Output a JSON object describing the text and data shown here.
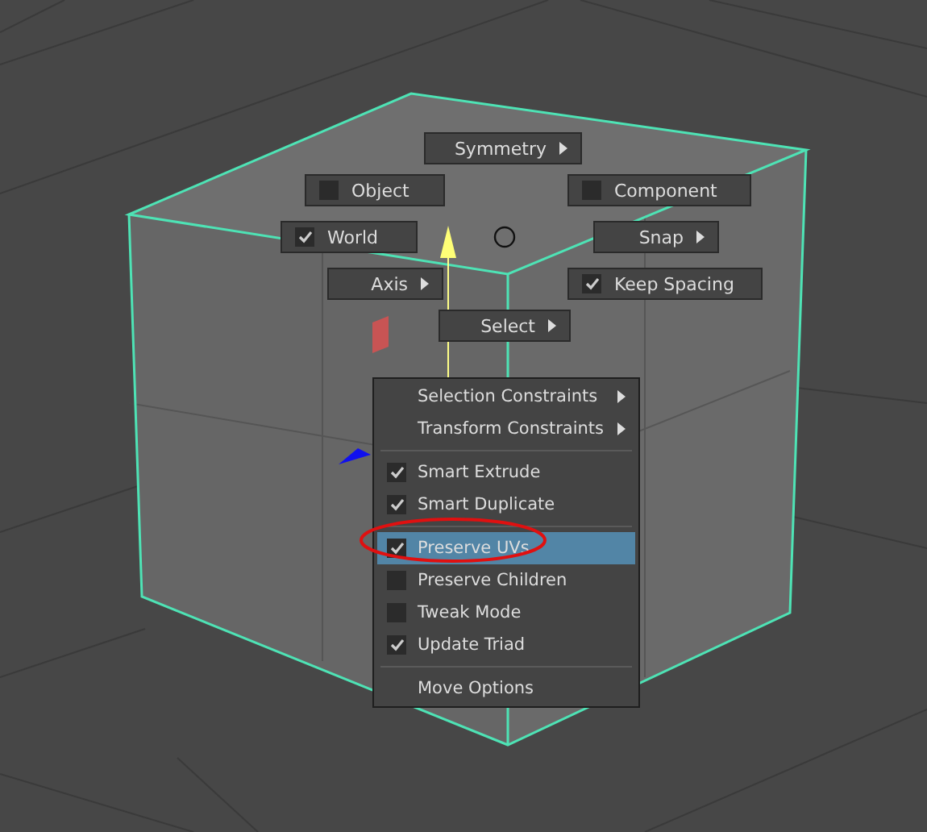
{
  "marking_menu": [
    {
      "label": "Symmetry",
      "kind": "submenu"
    },
    {
      "label": "Object",
      "kind": "check",
      "checked": false
    },
    {
      "label": "Component",
      "kind": "check",
      "checked": false
    },
    {
      "label": "World",
      "kind": "check",
      "checked": true
    },
    {
      "label": "Snap",
      "kind": "submenu"
    },
    {
      "label": "Axis",
      "kind": "submenu"
    },
    {
      "label": "Keep Spacing",
      "kind": "check",
      "checked": true
    },
    {
      "label": "Select",
      "kind": "submenu"
    }
  ],
  "context_menu": {
    "sections": [
      [
        {
          "label": "Selection Constraints",
          "kind": "submenu",
          "selected": false
        },
        {
          "label": "Transform Constraints",
          "kind": "submenu",
          "selected": false
        }
      ],
      [
        {
          "label": "Smart Extrude",
          "kind": "check",
          "checked": true,
          "selected": false
        },
        {
          "label": "Smart Duplicate",
          "kind": "check",
          "checked": true,
          "selected": false
        }
      ],
      [
        {
          "label": "Preserve UVs",
          "kind": "check",
          "checked": true,
          "selected": true
        },
        {
          "label": "Preserve Children",
          "kind": "check",
          "checked": false,
          "selected": false
        },
        {
          "label": "Tweak Mode",
          "kind": "check",
          "checked": false,
          "selected": false
        },
        {
          "label": "Update Triad",
          "kind": "check",
          "checked": true,
          "selected": false
        }
      ],
      [
        {
          "label": "Move Options",
          "kind": "plain",
          "selected": false
        }
      ]
    ]
  }
}
